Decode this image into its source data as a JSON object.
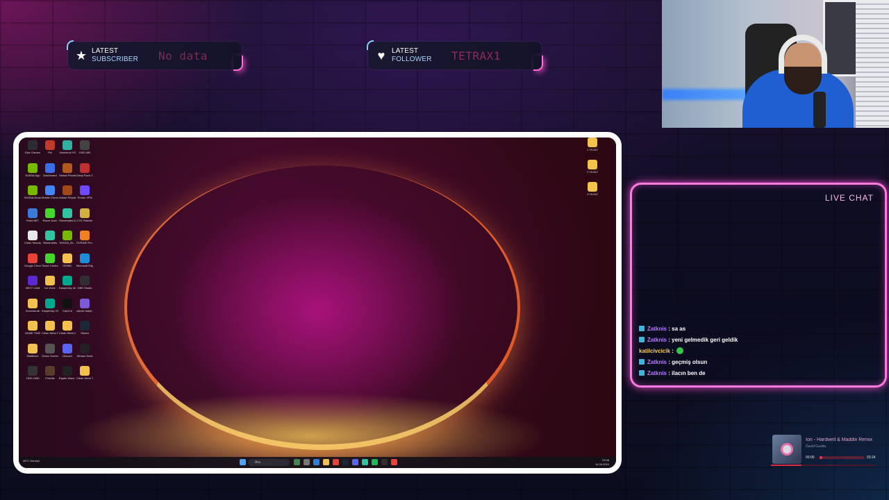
{
  "alerts": {
    "subscriber": {
      "label1": "LATEST",
      "label2": "SUBSCRIBER",
      "value": "No data",
      "icon": "star-icon"
    },
    "follower": {
      "label1": "LATEST",
      "label2": "FOLLOWER",
      "value": "TETRAX1",
      "icon": "heart-icon"
    }
  },
  "chat": {
    "title": "LIVE CHAT",
    "messages": [
      {
        "user": "Zatknis",
        "sep": " : ",
        "text": "sa as",
        "badge": true
      },
      {
        "user": "Zatknis",
        "sep": " : ",
        "text": "yeni gelmedik geri geldik",
        "badge": true
      },
      {
        "user": "katilcivcicik",
        "sep": " : ",
        "text": "",
        "badge": false,
        "emote": true
      },
      {
        "user": "Zatknis",
        "sep": " : ",
        "text": "geçmiş olsun",
        "badge": true
      },
      {
        "user": "Zatknis",
        "sep": " : ",
        "text": "ilacın ben de",
        "badge": true
      }
    ]
  },
  "music": {
    "song": "Ion - Hardwell & Maddix Remix",
    "artist": "David Guetta",
    "time_current": "00:00",
    "time_total": "03:24",
    "progress": 0.0
  },
  "desktop": {
    "icons": [
      {
        "label": "Epic Games",
        "color": "#2c2c34"
      },
      {
        "label": "RA",
        "color": "#c23a2a"
      },
      {
        "label": "Voicemod V3",
        "color": "#2fb0a0"
      },
      {
        "label": "1920-480",
        "color": "#444"
      },
      {
        "label": "NVIDIA App",
        "color": "#76b900"
      },
      {
        "label": "Dashboard",
        "color": "#3a6ee8"
      },
      {
        "label": "Seasd Private Server",
        "color": "#b05a20"
      },
      {
        "label": "Dizzy Rock Calendar",
        "color": "#c03030"
      },
      {
        "label": "NVIDIA Broadcast",
        "color": "#76b900"
      },
      {
        "label": "Mobile Chrome",
        "color": "#4285f4"
      },
      {
        "label": "Arkla2 Private Server",
        "color": "#a04a1a"
      },
      {
        "label": "Proton VPN",
        "color": "#6d4aff"
      },
      {
        "label": "Paint.NET",
        "color": "#3a7ad8"
      },
      {
        "label": "Razer Axon",
        "color": "#44d62c"
      },
      {
        "label": "Streamlabs Desktop",
        "color": "#31c3a2"
      },
      {
        "label": "CTE Patcher",
        "color": "#d0b040"
      },
      {
        "label": "Clean Nesnegmen",
        "color": "#e8e8e8"
      },
      {
        "label": "Streamlabs",
        "color": "#31c3a2"
      },
      {
        "label": "NVIDIA_Br...",
        "color": "#76b900"
      },
      {
        "label": "OVRIDE Pro Desktop",
        "color": "#f08020"
      },
      {
        "label": "Google Chrome",
        "color": "#e84336"
      },
      {
        "label": "Razer Cortex",
        "color": "#44d62c"
      },
      {
        "label": "GENEL",
        "color": "#f2c14e"
      },
      {
        "label": "Microsoft Edge",
        "color": "#1d8ed8"
      },
      {
        "label": "NEXT CAM",
        "color": "#5a2ad0"
      },
      {
        "label": "Ice Zone",
        "color": "#f2c14e"
      },
      {
        "label": "Kaspersky Internet...",
        "color": "#00a88e"
      },
      {
        "label": "OBS Studio",
        "color": "#302e31"
      },
      {
        "label": "SoundsLab",
        "color": "#f2c14e"
      },
      {
        "label": "Kaspersky VPN",
        "color": "#00a88e"
      },
      {
        "label": "CapCut",
        "color": "#111"
      },
      {
        "label": "cdpckr bakip tamam",
        "color": "#7a5ad8"
      },
      {
        "label": "GAME TIME",
        "color": "#f2c14e"
      },
      {
        "label": "Clean Neon Panels",
        "color": "#f2c14e"
      },
      {
        "label": "Clean Neon intermission",
        "color": "#f2c14e"
      },
      {
        "label": "Steam",
        "color": "#1b2838"
      },
      {
        "label": "StatBlaze",
        "color": "#f2c14e"
      },
      {
        "label": "Green Screen 60s assets",
        "color": "#555"
      },
      {
        "label": "Discord",
        "color": "#5865f2"
      },
      {
        "label": "Stream Deck",
        "color": "#222"
      },
      {
        "label": "1920-1080",
        "color": "#333"
      },
      {
        "label": "Fortnite",
        "color": "#5a3a2a"
      },
      {
        "label": "Elgato Wave Link",
        "color": "#222"
      },
      {
        "label": "Clean Neon Twitch Chat",
        "color": "#f2c14e"
      }
    ],
    "right_icons": [
      {
        "label": "1 YILDIZ"
      },
      {
        "label": "2 YILDIZ"
      },
      {
        "label": "3 YILDIZ"
      }
    ],
    "taskbar": {
      "weather": "48°C Güneşli",
      "search_placeholder": "Ara",
      "time": "23:38",
      "date": "14.09.2024"
    }
  }
}
